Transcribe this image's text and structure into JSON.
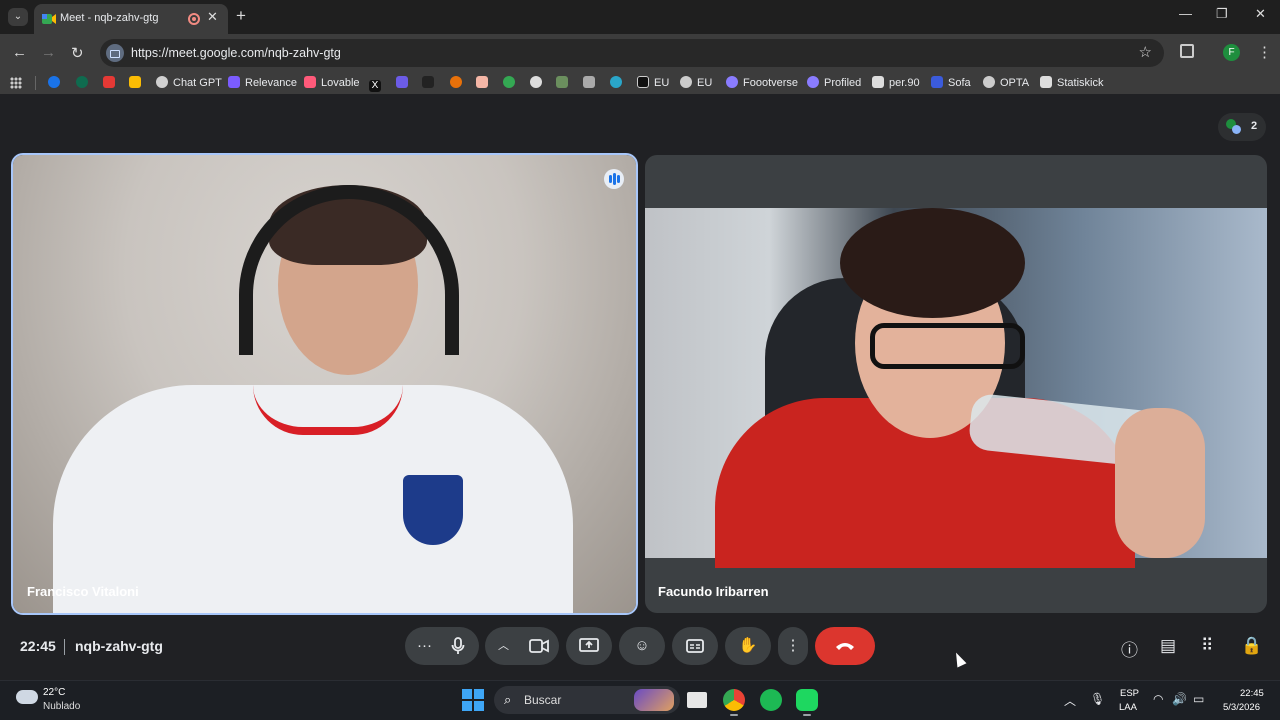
{
  "browser": {
    "tab_title": "Meet - nqb-zahv-gtg",
    "url": "https://meet.google.com/nqb-zahv-gtg",
    "profile_initial": "F"
  },
  "bookmarks": [
    {
      "label": "Chat GPT",
      "icon": "openai-icon",
      "color": "#d0d0d0"
    },
    {
      "label": "Relevance",
      "icon": "relevance-icon",
      "color": "#7b5cff"
    },
    {
      "label": "Lovable",
      "icon": "lovable-icon",
      "color": "#ff5a7a"
    },
    {
      "label": "EU",
      "icon": "eu-icon",
      "color": "#111111"
    },
    {
      "label": "EU",
      "icon": "eu2-icon",
      "color": "#cccccc"
    },
    {
      "label": "Foootverse",
      "icon": "foootverse-icon",
      "color": "#8a7cff"
    },
    {
      "label": "Profiled",
      "icon": "profiled-icon",
      "color": "#8a7cff"
    },
    {
      "label": "per.90",
      "icon": "per90-icon",
      "color": "#dddddd"
    },
    {
      "label": "Sofa",
      "icon": "sofa-icon",
      "color": "#3b5bdb"
    },
    {
      "label": "OPTA",
      "icon": "opta-icon",
      "color": "#cccccc"
    },
    {
      "label": "Statiskick",
      "icon": "statiskick-icon",
      "color": "#dddddd"
    }
  ],
  "meet": {
    "participant_count": "2",
    "participants": [
      {
        "name": "Francisco Vitaloni"
      },
      {
        "name": "Facundo Iribarren"
      }
    ],
    "time": "22:45",
    "meeting_code": "nqb-zahv-gtg"
  },
  "taskbar": {
    "temperature": "22°C",
    "condition": "Nublado",
    "search_label": "Buscar",
    "lang_line1": "ESP",
    "lang_line2": "LAA",
    "time": "22:45",
    "date": "5/3/2026"
  },
  "colors": {
    "end_call": "#dc362e",
    "speaker_border": "#a8c7fa",
    "meet_bg": "#202124"
  }
}
